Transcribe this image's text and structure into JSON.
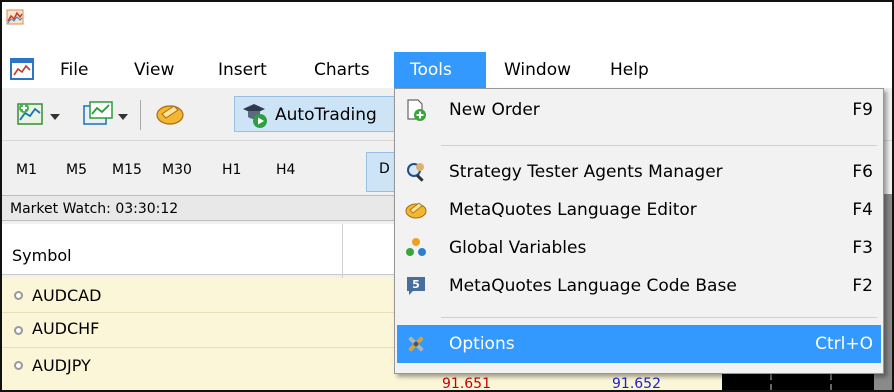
{
  "menubar": {
    "items": [
      "File",
      "View",
      "Insert",
      "Charts",
      "Tools",
      "Window",
      "Help"
    ],
    "active": "Tools"
  },
  "toolbar": {
    "autotrading_label": "AutoTrading"
  },
  "timeframes": [
    "M1",
    "M5",
    "M15",
    "M30",
    "H1",
    "H4",
    "D"
  ],
  "market_watch": {
    "title": "Market Watch: 03:30:12",
    "columns": [
      "Symbol",
      "",
      ""
    ],
    "rows": [
      {
        "symbol": "AUDCAD",
        "bid": "",
        "ask": ""
      },
      {
        "symbol": "AUDCHF",
        "bid": "",
        "ask": ""
      },
      {
        "symbol": "AUDJPY",
        "bid": "91.651",
        "ask": "91.652"
      }
    ]
  },
  "tools_menu": {
    "items": [
      {
        "label": "New Order",
        "shortcut": "F9",
        "icon": "new-order-icon"
      },
      {
        "label": "Strategy Tester Agents Manager",
        "shortcut": "F6",
        "icon": "agents-manager-icon"
      },
      {
        "label": "MetaQuotes Language Editor",
        "shortcut": "F4",
        "icon": "metaeditor-icon"
      },
      {
        "label": "Global Variables",
        "shortcut": "F3",
        "icon": "global-variables-icon"
      },
      {
        "label": "MetaQuotes Language Code Base",
        "shortcut": "F2",
        "icon": "code-base-icon"
      },
      {
        "label": "Options",
        "shortcut": "Ctrl+O",
        "icon": "options-icon"
      }
    ],
    "highlighted": "Options"
  },
  "colors": {
    "menu_highlight": "#3399ff",
    "autotrading_bg": "#cde4f7",
    "market_row_bg": "#fcf6d8",
    "bid_color": "#cc0000",
    "ask_color": "#2222cc"
  }
}
